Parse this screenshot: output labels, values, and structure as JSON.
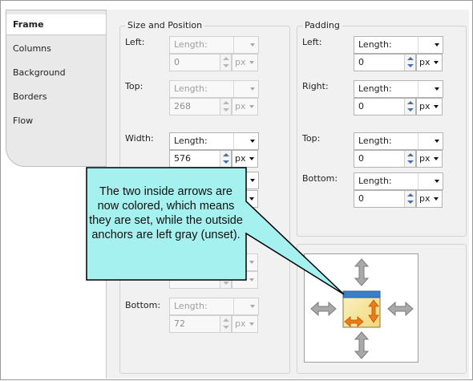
{
  "tabs": [
    {
      "label": "Frame",
      "active": true
    },
    {
      "label": "Columns",
      "active": false
    },
    {
      "label": "Background",
      "active": false
    },
    {
      "label": "Borders",
      "active": false
    },
    {
      "label": "Flow",
      "active": false
    }
  ],
  "size_position": {
    "title": "Size and Position",
    "left": {
      "label": "Left:",
      "unit_type": "Length:",
      "value": "0",
      "unit": "px",
      "enabled": false
    },
    "top": {
      "label": "Top:",
      "unit_type": "Length:",
      "value": "268",
      "unit": "px",
      "enabled": false
    },
    "width": {
      "label": "Width:",
      "unit_type": "Length:",
      "value": "576",
      "unit": "px",
      "enabled": true
    },
    "bottom": {
      "label": "Bottom:",
      "unit_type": "Length:",
      "value": "72",
      "unit": "px",
      "enabled": false
    }
  },
  "padding": {
    "title": "Padding",
    "left": {
      "label": "Left:",
      "unit_type": "Length:",
      "value": "0",
      "unit": "px"
    },
    "right": {
      "label": "Right:",
      "unit_type": "Length:",
      "value": "0",
      "unit": "px"
    },
    "top": {
      "label": "Top:",
      "unit_type": "Length:",
      "value": "0",
      "unit": "px"
    },
    "bottom": {
      "label": "Bottom:",
      "unit_type": "Length:",
      "value": "0",
      "unit": "px"
    }
  },
  "callout": {
    "text": "The two inside arrows are now colored, which means they are set, while the outside anchors are left gray (unset)."
  },
  "colors": {
    "callout_fill": "#a4f1ef",
    "callout_border": "#000000",
    "anchor_gray": "#9b9b9b",
    "anchor_orange": "#ef7a1a",
    "box_blue": "#3d7fc4",
    "box_yellow": "#f7e59a"
  }
}
